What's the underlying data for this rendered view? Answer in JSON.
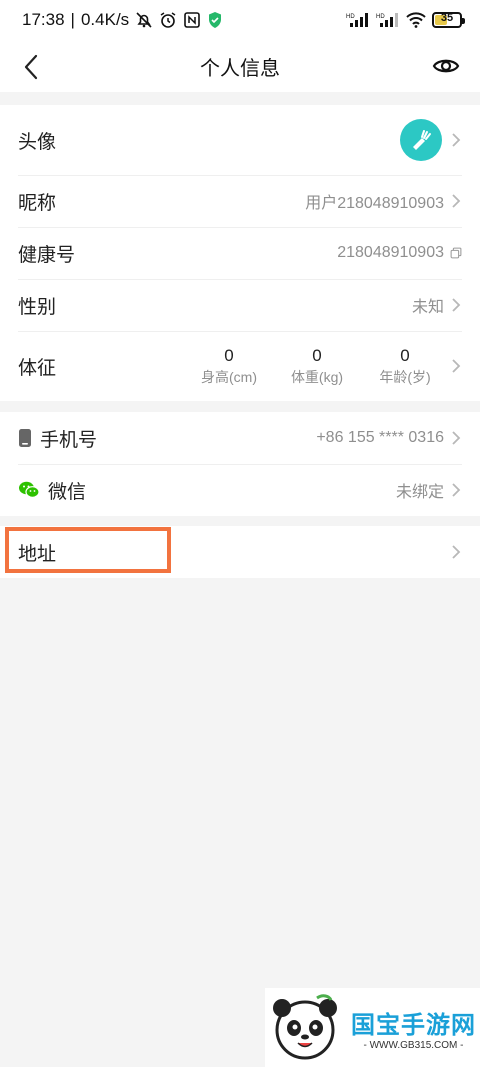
{
  "status_bar": {
    "time": "17:38",
    "separator": "|",
    "speed": "0.4K/s",
    "battery": "35"
  },
  "header": {
    "title": "个人信息"
  },
  "profile": {
    "avatar_label": "头像",
    "nickname_label": "昵称",
    "nickname_value": "用户218048910903",
    "health_id_label": "健康号",
    "health_id_value": "218048910903",
    "gender_label": "性别",
    "gender_value": "未知",
    "body_label": "体征",
    "vitals": [
      {
        "value": "0",
        "label": "身高(cm)"
      },
      {
        "value": "0",
        "label": "体重(kg)"
      },
      {
        "value": "0",
        "label": "年龄(岁)"
      }
    ]
  },
  "account": {
    "phone_label": "手机号",
    "phone_value": "+86 155 **** 0316",
    "wechat_label": "微信",
    "wechat_value": "未绑定"
  },
  "address": {
    "label": "地址"
  },
  "watermark": {
    "title": "国宝手游网",
    "url": "- WWW.GB315.COM -"
  },
  "colors": {
    "avatar_bg": "#2cc8c4",
    "highlight": "#f2733f",
    "wechat": "#2dc100"
  }
}
